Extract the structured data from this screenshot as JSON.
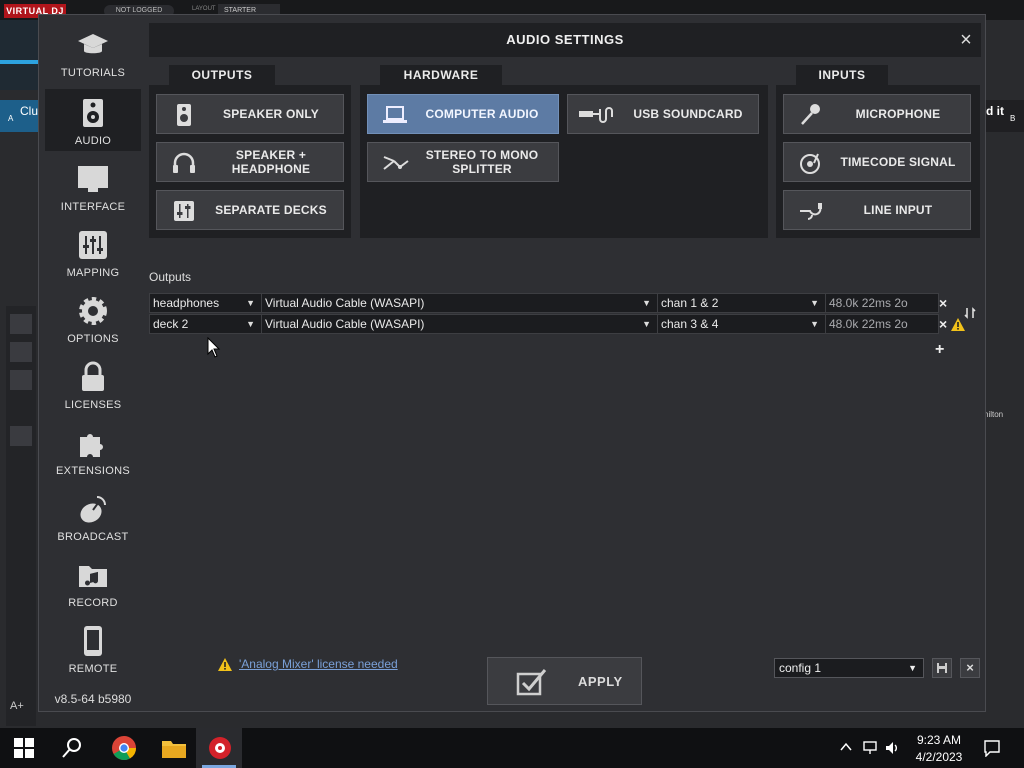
{
  "background_app": {
    "logo": "VIRTUAL DJ",
    "login_status": "NOT LOGGED",
    "layout_label": "LAYOUT",
    "layout_value": "STARTER",
    "left_deck_title": "Clu",
    "left_deck_letter": "A",
    "right_deck_title": "d it",
    "right_deck_letter": "B",
    "right_list_name": "hilton",
    "font_size_label": "A+"
  },
  "dialog": {
    "title": "AUDIO SETTINGS",
    "close_label": "×"
  },
  "sidebar": {
    "items": [
      {
        "label": "TUTORIALS",
        "icon": "graduation-cap-icon"
      },
      {
        "label": "AUDIO",
        "icon": "speaker-icon",
        "active": true
      },
      {
        "label": "INTERFACE",
        "icon": "monitor-icon"
      },
      {
        "label": "MAPPING",
        "icon": "sliders-icon"
      },
      {
        "label": "OPTIONS",
        "icon": "gear-icon"
      },
      {
        "label": "LICENSES",
        "icon": "lock-icon"
      },
      {
        "label": "EXTENSIONS",
        "icon": "puzzle-icon"
      },
      {
        "label": "BROADCAST",
        "icon": "satellite-dish-icon"
      },
      {
        "label": "RECORD",
        "icon": "music-folder-icon"
      },
      {
        "label": "REMOTE",
        "icon": "smartphone-icon"
      }
    ],
    "version": "v8.5-64 b5980"
  },
  "outputs_panel": {
    "tab": "OUTPUTS",
    "buttons": [
      {
        "label": "SPEAKER ONLY",
        "icon": "speaker-icon"
      },
      {
        "label": "SPEAKER + HEADPHONE",
        "icon": "headphones-icon"
      },
      {
        "label": "SEPARATE DECKS",
        "icon": "mixer-icon"
      }
    ]
  },
  "hardware_panel": {
    "tab": "HARDWARE",
    "buttons": [
      {
        "label": "COMPUTER AUDIO",
        "icon": "laptop-icon",
        "selected": true
      },
      {
        "label": "USB SOUNDCARD",
        "icon": "usb-icon"
      },
      {
        "label": "STEREO TO MONO SPLITTER",
        "icon": "splitter-cable-icon"
      }
    ]
  },
  "inputs_panel": {
    "tab": "INPUTS",
    "buttons": [
      {
        "label": "MICROPHONE",
        "icon": "microphone-icon"
      },
      {
        "label": "TIMECODE SIGNAL",
        "icon": "turntable-icon"
      },
      {
        "label": "LINE INPUT",
        "icon": "cable-plug-icon"
      }
    ]
  },
  "outputs_table": {
    "heading": "Outputs",
    "rows": [
      {
        "output": "headphones",
        "device": "Virtual Audio Cable (WASAPI)",
        "channels": "chan 1 & 2",
        "latency": "48.0k 22ms 2o"
      },
      {
        "output": "deck 2",
        "device": "Virtual Audio Cable (WASAPI)",
        "channels": "chan 3 & 4",
        "latency": "48.0k 22ms 2o"
      }
    ],
    "add_label": "+",
    "remove_label": "×"
  },
  "footer": {
    "license_warning": "'Analog Mixer' license needed",
    "apply_label": "APPLY",
    "config_value": "config 1",
    "delete_config_label": "×"
  },
  "taskbar": {
    "time": "9:23 AM",
    "date": "4/2/2023"
  },
  "colors": {
    "accent_selected": "#5d7ba4",
    "warning": "#f2c21a",
    "link": "#7aa0d8"
  }
}
